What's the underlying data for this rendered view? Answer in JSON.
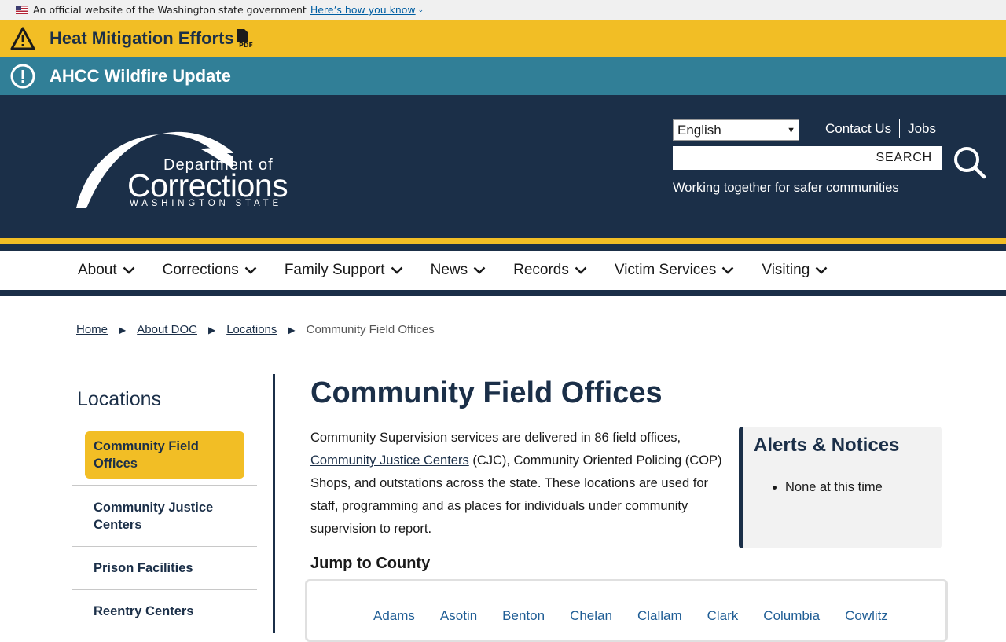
{
  "gov_banner": {
    "text": "An official website of the Washington state government",
    "link": "Here’s how you know",
    "chevron": "⌄"
  },
  "alerts_top": [
    {
      "title": "Heat Mitigation Efforts",
      "icon": "warning-triangle-icon",
      "color": "#f2be25"
    },
    {
      "title": "AHCC Wildfire Update",
      "icon": "exclamation-circle-icon",
      "color": "#317f97"
    }
  ],
  "logo": {
    "line1": "Department of",
    "line2": "Corrections",
    "line3": "WASHINGTON STATE"
  },
  "header": {
    "language": "English",
    "links": [
      "Contact Us",
      "Jobs"
    ],
    "search_label": "SEARCH",
    "tagline": "Working together for safer communities"
  },
  "nav": [
    "About",
    "Corrections",
    "Family Support",
    "News",
    "Records",
    "Victim Services",
    "Visiting"
  ],
  "breadcrumb": {
    "links": [
      "Home",
      "About DOC",
      "Locations"
    ],
    "current": "Community Field Offices"
  },
  "sidebar": {
    "title": "Locations",
    "items": [
      "Community Field Offices",
      "Community Justice Centers",
      "Prison Facilities",
      "Reentry Centers"
    ]
  },
  "main": {
    "title": "Community Field Offices",
    "intro_pre": "Community Supervision services are delivered in 86 field offices, ",
    "intro_link": "Community Justice Centers",
    "intro_post": " (CJC), Community Oriented Policing (COP) Shops, and outstations across the state. These locations are used for staff, programming and as places for individuals under community supervision to report."
  },
  "alerts_box": {
    "title": "Alerts & Notices",
    "items": [
      "None at this time"
    ]
  },
  "jump": {
    "title": "Jump to County",
    "counties": [
      "Adams",
      "Asotin",
      "Benton",
      "Chelan",
      "Clallam",
      "Clark",
      "Columbia",
      "Cowlitz"
    ]
  },
  "colors": {
    "navy": "#1b2f48",
    "gold": "#f2be25",
    "teal": "#317f97"
  }
}
